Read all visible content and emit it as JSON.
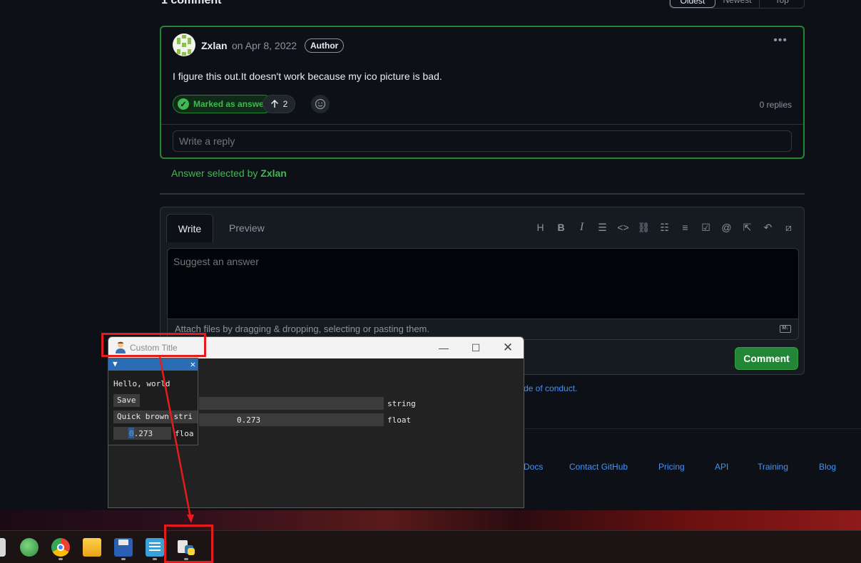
{
  "discussion": {
    "title": "1 comment",
    "sort_options": [
      "Oldest",
      "Newest",
      "Top"
    ]
  },
  "comment": {
    "author": "Zxlan",
    "date": "on Apr 8, 2022",
    "badge": "Author",
    "body": "I figure this out.It doesn't work because my ico picture is bad.",
    "answer_label": "Marked as answer",
    "upvotes": "2",
    "replies": "0 replies",
    "reply_placeholder": "Write a reply"
  },
  "answer_selected": {
    "prefix": "Answer selected by ",
    "user": "Zxlan"
  },
  "editor": {
    "tab_write": "Write",
    "tab_preview": "Preview",
    "toolbar": [
      "heading-icon",
      "bold-icon",
      "italic-icon",
      "quote-icon",
      "code-icon",
      "link-icon",
      "bulleted-list-icon",
      "numbered-list-icon",
      "task-list-icon",
      "mention-icon",
      "reference-icon",
      "reply-icon",
      "slash-command-icon"
    ],
    "placeholder": "Suggest an answer",
    "attach_text": "Attach files by dragging & dropping, selecting or pasting them.",
    "submit_label": "Comment",
    "conduct_text": "de of conduct."
  },
  "footer": {
    "links": [
      "Docs",
      "Contact GitHub",
      "Pricing",
      "API",
      "Training",
      "Blog"
    ]
  },
  "window": {
    "title": "Custom Title",
    "main_fields": [
      {
        "value": "",
        "label": "string"
      },
      {
        "value": "0.273",
        "label": "float"
      }
    ]
  },
  "imgui": {
    "text": "Hello, world",
    "button": "Save",
    "input_text": "Quick brown stri",
    "float_value": "0.273",
    "float_label": "floa"
  },
  "taskbar": {
    "icons": [
      "edge-icon",
      "globe-icon",
      "chrome-icon",
      "file-explorer-icon",
      "floppy-save-icon",
      "notepad-icon",
      "python-icon"
    ]
  },
  "colors": {
    "accent_green": "#238636",
    "link_blue": "#4493f8",
    "annotation_red": "#e51c1c",
    "imgui_blue": "#2a6db5"
  }
}
